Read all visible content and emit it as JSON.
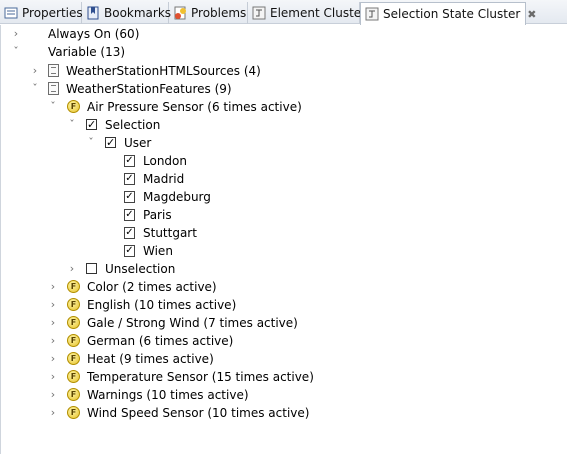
{
  "tabs": [
    {
      "label": "Properties",
      "icon": "properties-icon"
    },
    {
      "label": "Bookmarks",
      "icon": "bookmarks-icon"
    },
    {
      "label": "Problems",
      "icon": "problems-icon"
    },
    {
      "label": "Element Cluster",
      "icon": "element-cluster-icon"
    },
    {
      "label": "Selection State Cluster",
      "icon": "selection-state-cluster-icon",
      "active": true,
      "close": "✖"
    }
  ],
  "tree": {
    "always_on": "Always On (60)",
    "variable": "Variable (13)",
    "html_sources": "WeatherStationHTMLSources (4)",
    "features": "WeatherStationFeatures (9)",
    "air_pressure": "Air Pressure Sensor (6 times active)",
    "selection": "Selection",
    "user": "User",
    "leaves": [
      "London",
      "Madrid",
      "Magdeburg",
      "Paris",
      "Stuttgart",
      "Wien"
    ],
    "unselection": "Unselection",
    "features_list": [
      "Color (2 times active)",
      "English (10 times active)",
      "Gale / Strong Wind (7 times active)",
      "German (6 times active)",
      "Heat (9 times active)",
      "Temperature Sensor (15 times active)",
      "Warnings (10 times active)",
      "Wind Speed Sensor (10 times active)"
    ],
    "feature_badge": "F",
    "check_mark": "✓",
    "twisty_collapsed": "›",
    "twisty_expanded": "ˇ"
  }
}
